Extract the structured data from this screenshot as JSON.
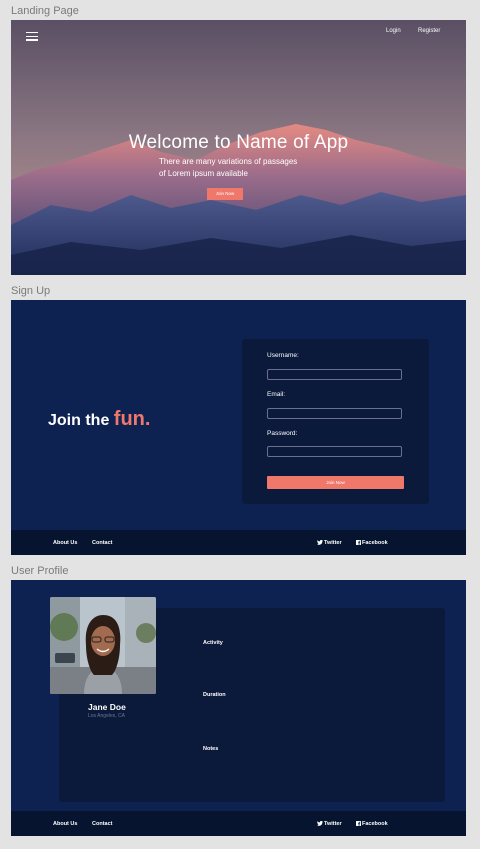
{
  "frames": {
    "landing_label": "Landing Page",
    "signup_label": "Sign Up",
    "profile_label": "User Profile"
  },
  "landing": {
    "menu_icon": "hamburger-icon",
    "nav": {
      "login": "Login",
      "register": "Register"
    },
    "title": "Welcome to Name of App",
    "subtitle_line1": "There are many variations of passages",
    "subtitle_line2": "of Lorem ipsum available",
    "cta": "Join Now"
  },
  "signup": {
    "headline": "Join the",
    "headline_accent": "fun.",
    "username_label": "Username:",
    "username_value": "",
    "email_label": "Email:",
    "email_value": "",
    "password_label": "Password:",
    "password_value": "",
    "submit": "Join Now"
  },
  "footer": {
    "about": "About Us",
    "contact": "Contact",
    "twitter": "Twitter",
    "facebook": "Facebook",
    "twitter_icon": "twitter-icon",
    "facebook_icon": "facebook-icon"
  },
  "profile": {
    "name": "Jane Doe",
    "location": "Los Angeles, CA",
    "activity": "Activity",
    "duration": "Duration",
    "notes": "Notes"
  },
  "colors": {
    "accent": "#f0786b",
    "navy": "#0d2250",
    "card": "#0b1a3b",
    "footer": "#061430"
  }
}
